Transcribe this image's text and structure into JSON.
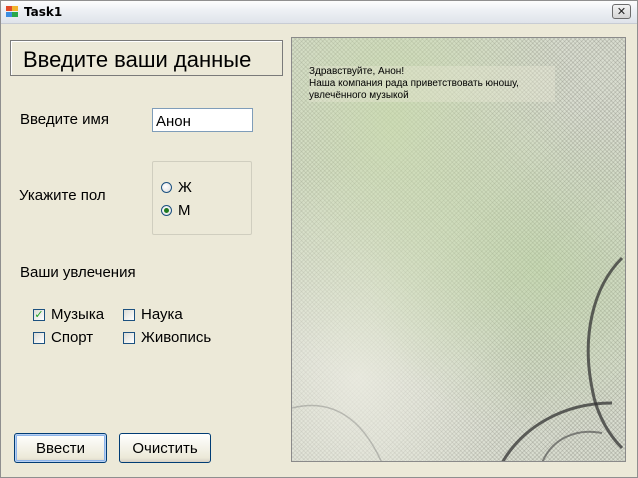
{
  "window": {
    "title": "Task1",
    "close_glyph": "✕",
    "icon": "app-window-icon"
  },
  "form": {
    "heading": "Введите ваши данные",
    "name_label": "Введите имя",
    "name_value": "Анон",
    "gender_label": "Укажите пол",
    "gender_options": [
      {
        "label": "Ж",
        "checked": false
      },
      {
        "label": "М",
        "checked": true
      }
    ],
    "hobbies_label": "Ваши увлечения",
    "hobbies": [
      {
        "label": "Музыка",
        "checked": true
      },
      {
        "label": "Наука",
        "checked": false
      },
      {
        "label": "Спорт",
        "checked": false
      },
      {
        "label": "Живопись",
        "checked": false
      }
    ],
    "submit_label": "Ввести",
    "clear_label": "Очистить"
  },
  "output": {
    "lines": [
      "Здравствуйте, Анон!",
      "Наша компания рада приветствовать юношу,",
      "увлечённого музыкой"
    ]
  },
  "colors": {
    "check_mark": "#21a121",
    "radio_dot": "#1f7a1f"
  }
}
